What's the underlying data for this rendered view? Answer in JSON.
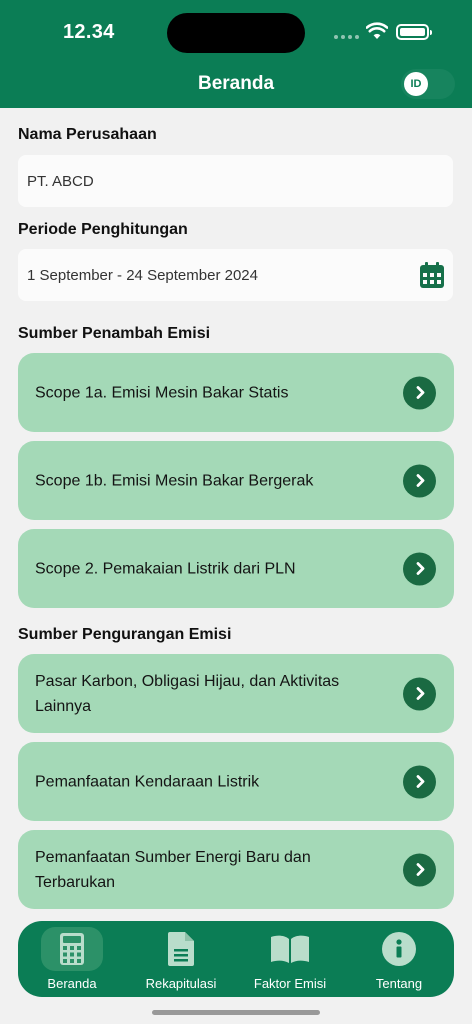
{
  "status_bar": {
    "time": "12.34"
  },
  "nav": {
    "title": "Beranda",
    "lang_toggle": "ID"
  },
  "company": {
    "label": "Nama Perusahaan",
    "value": "PT. ABCD"
  },
  "period": {
    "label": "Periode Penghitungan",
    "value": "1 September - 24 September 2024"
  },
  "emission_sources": {
    "label": "Sumber Penambah Emisi",
    "items": [
      {
        "label": "Scope 1a. Emisi Mesin Bakar Statis"
      },
      {
        "label": "Scope 1b. Emisi Mesin Bakar Bergerak"
      },
      {
        "label": "Scope 2. Pemakaian Listrik dari PLN"
      }
    ]
  },
  "reduction_sources": {
    "label": "Sumber Pengurangan Emisi",
    "items": [
      {
        "label": "Pasar Karbon, Obligasi Hijau, dan Aktivitas Lainnya"
      },
      {
        "label": "Pemanfaatan Kendaraan Listrik"
      },
      {
        "label": "Pemanfaatan Sumber Energi Baru dan Terbarukan"
      }
    ]
  },
  "tabs": [
    {
      "label": "Beranda",
      "icon": "calculator-icon",
      "active": true
    },
    {
      "label": "Rekapitulasi",
      "icon": "document-icon",
      "active": false
    },
    {
      "label": "Faktor Emisi",
      "icon": "book-icon",
      "active": false
    },
    {
      "label": "Tentang",
      "icon": "info-icon",
      "active": false
    }
  ],
  "colors": {
    "primary": "#0b7d55",
    "card": "#a4d9b7",
    "arrow": "#1a6a42",
    "background": "#f1f1f1"
  }
}
